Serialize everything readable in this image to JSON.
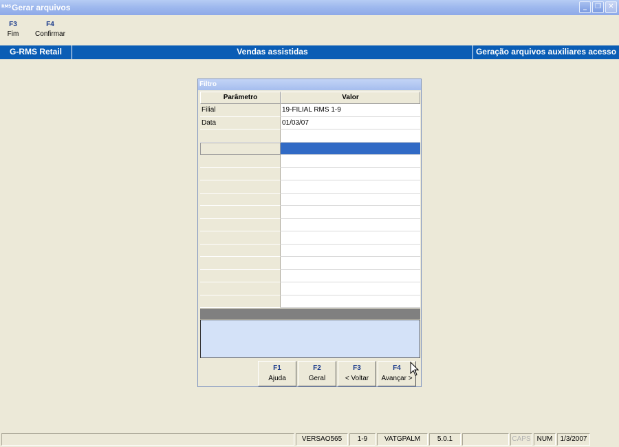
{
  "window": {
    "icon_text": "RMS",
    "title": "Gerar arquivos",
    "minimize_glyph": "_",
    "maximize_glyph": "❐",
    "close_glyph": "✕"
  },
  "toolbar": {
    "keys": [
      {
        "key": "F3",
        "label": "Fim"
      },
      {
        "key": "F4",
        "label": "Confirmar"
      }
    ]
  },
  "header_band": {
    "left": "G-RMS Retail",
    "center": "Vendas assistidas",
    "right": "Geração arquivos auxiliares acesso"
  },
  "dialog": {
    "title": "Filtro",
    "columns": [
      "Parâmetro",
      "Valor"
    ],
    "rows": [
      {
        "param": "Filial",
        "value": "19-FILIAL RMS 1-9"
      },
      {
        "param": "Data",
        "value": "01/03/07"
      },
      {
        "param": "",
        "value": ""
      },
      {
        "param": "",
        "value": ""
      },
      {
        "param": "",
        "value": ""
      },
      {
        "param": "",
        "value": ""
      },
      {
        "param": "",
        "value": ""
      },
      {
        "param": "",
        "value": ""
      },
      {
        "param": "",
        "value": ""
      },
      {
        "param": "",
        "value": ""
      },
      {
        "param": "",
        "value": ""
      },
      {
        "param": "",
        "value": ""
      },
      {
        "param": "",
        "value": ""
      },
      {
        "param": "",
        "value": ""
      },
      {
        "param": "",
        "value": ""
      },
      {
        "param": "",
        "value": ""
      }
    ],
    "selected_row_index": 3,
    "buttons": [
      {
        "key": "F1",
        "label": "Ajuda"
      },
      {
        "key": "F2",
        "label": "Geral"
      },
      {
        "key": "F3",
        "label": "< Voltar"
      },
      {
        "key": "F4",
        "label": "Avançar >"
      }
    ]
  },
  "status_bar": {
    "panels": [
      "",
      "VERSAO565",
      "1-9",
      "VATGPALM",
      "5.0.1",
      "",
      "CAPS",
      "NUM",
      "1/3/2007"
    ]
  },
  "colors": {
    "band": "#0A5DB5",
    "selection": "#316AC5",
    "memo": "#D4E2F8"
  }
}
